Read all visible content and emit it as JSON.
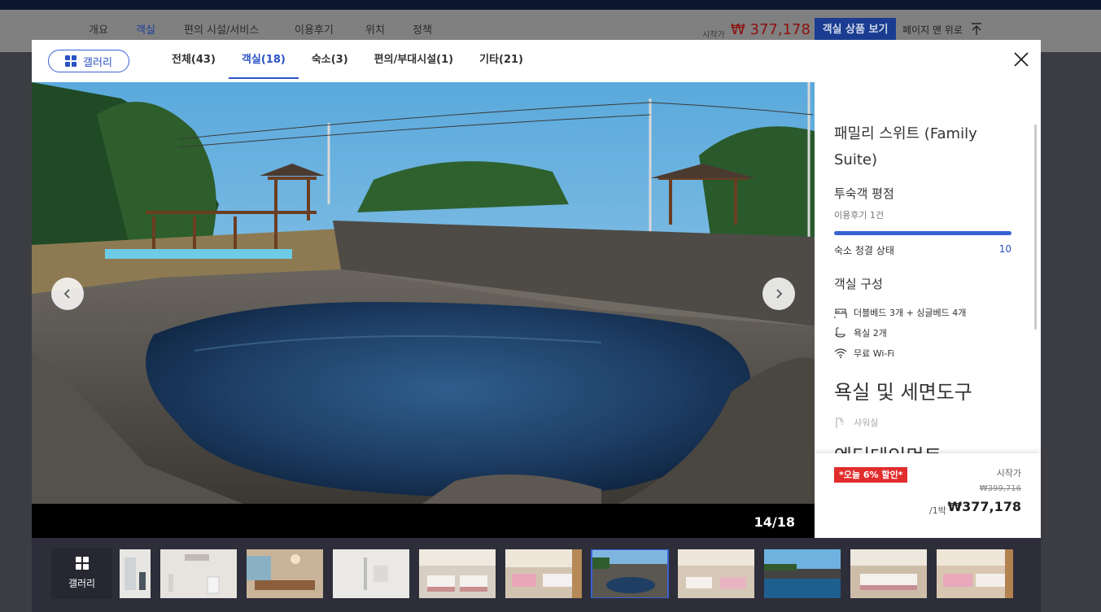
{
  "background_page": {
    "nav_tabs": [
      "개요",
      "객실",
      "편의 시설/서비스",
      "이용후기",
      "위치",
      "정책"
    ],
    "active_tab_index": 1,
    "price_from_label": "시작가",
    "price": "₩ 377,178",
    "view_rooms_label": "객실 상품 보기",
    "to_top_label": "페이지 맨 위로"
  },
  "header": {
    "gallery_label": "갤러리",
    "tabs": [
      {
        "label": "전체(43)"
      },
      {
        "label": "객실(18)"
      },
      {
        "label": "숙소(3)"
      },
      {
        "label": "편의/부대시설(1)"
      },
      {
        "label": "기타(21)"
      }
    ],
    "active_tab_index": 1
  },
  "viewer": {
    "counter": "14/18",
    "accent": "#3a62d3"
  },
  "room": {
    "title": "패밀리 스위트 (Family Suite)",
    "guest_rating_heading": "투숙객 평점",
    "review_count": "이용후기 1건",
    "cleanliness_label": "숙소 청결 상태",
    "cleanliness_score": "10",
    "config_heading": "객실 구성",
    "features": [
      {
        "icon": "bed-icon",
        "text": "더블베드 3개 + 싱글베드 4개"
      },
      {
        "icon": "bathtub-icon",
        "text": "욕실 2개"
      },
      {
        "icon": "wifi-icon",
        "text": "무료 Wi-Fi"
      }
    ],
    "bath_heading": "욕실 및 세면도구",
    "bath_item": "샤워실",
    "entertainment_heading": "엔터테인먼트"
  },
  "pricing": {
    "discount_badge": "*오늘 6% 할인*",
    "from_label": "시작가",
    "original_price": "₩399,716",
    "per_night": "/1박",
    "final_price": "₩377,178",
    "badge_color": "#e12d2d"
  },
  "strip": {
    "gallery_label": "갤러리",
    "selected_index": 6
  }
}
